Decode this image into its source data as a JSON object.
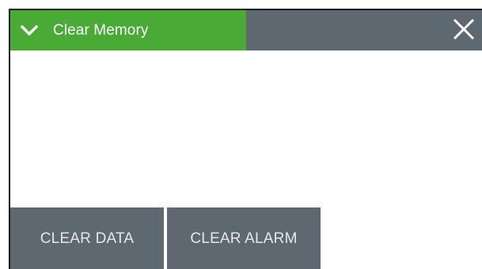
{
  "header": {
    "title": "Clear Memory",
    "expand_icon": "chevron-down-icon",
    "close_icon": "close-icon"
  },
  "actions": {
    "clear_data_label": "CLEAR DATA",
    "clear_alarm_label": "CLEAR ALARM"
  },
  "colors": {
    "accent": "#4aaa36",
    "panel": "#5e6870",
    "button_text": "#e4e7ea"
  }
}
